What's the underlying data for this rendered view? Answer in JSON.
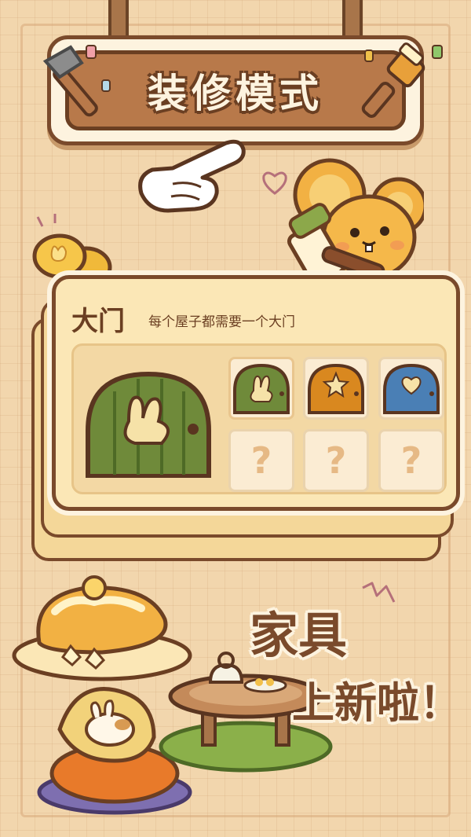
{
  "banner": {
    "title": "装修模式"
  },
  "door_card": {
    "title": "大门",
    "subtitle": "每个屋子都需要一个大门",
    "selected_door": "bunny-door",
    "doors": [
      {
        "name": "bunny-door",
        "color": "#6f8a3a",
        "emblem": "bunny",
        "locked": false
      },
      {
        "name": "star-door",
        "color": "#d9881f",
        "emblem": "star",
        "locked": false
      },
      {
        "name": "heart-door",
        "color": "#4a7fb5",
        "emblem": "heart",
        "locked": false
      },
      {
        "name": "locked-door",
        "label": "?",
        "locked": true
      },
      {
        "name": "locked-door",
        "label": "?",
        "locked": true
      },
      {
        "name": "locked-door",
        "label": "?",
        "locked": true
      }
    ]
  },
  "promo": {
    "line1": "家具",
    "line2": "上新啦！"
  },
  "colors": {
    "background": "#f2d6ad",
    "wood_dark": "#6b3f22",
    "wood": "#b8794a",
    "cream": "#fdf3df",
    "card": "#fbe7b6"
  }
}
